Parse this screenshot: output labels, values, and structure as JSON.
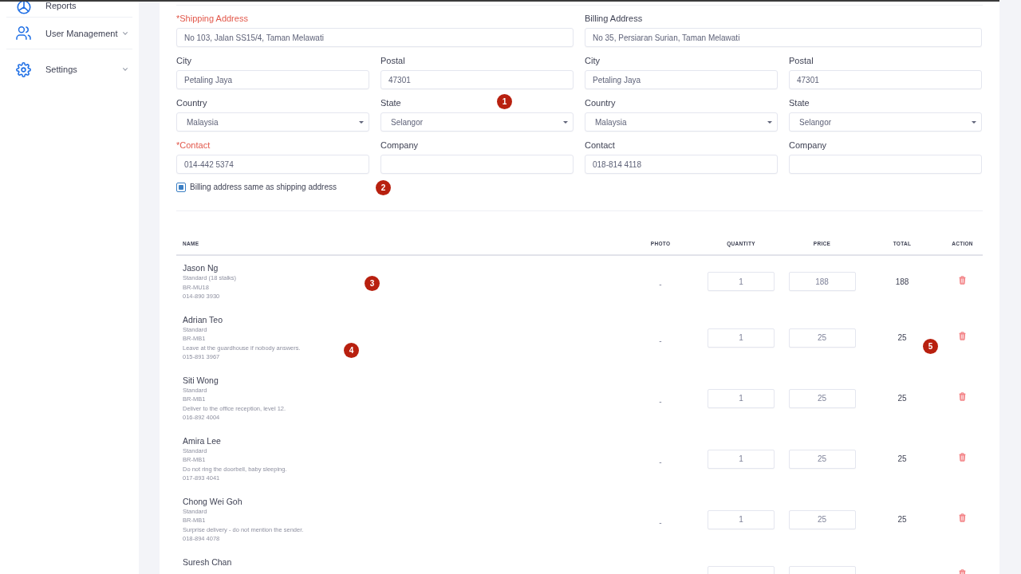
{
  "sidebar": {
    "items": [
      {
        "label": "Reports"
      },
      {
        "label": "User Management",
        "expanded": false
      },
      {
        "label": "Settings",
        "expanded": false
      }
    ]
  },
  "shipping": {
    "fields": [
      {
        "kind": "text",
        "label": "*Shipping Address",
        "required": true,
        "value": "No 103, Jalan SS15/4, Taman Melawati"
      },
      {
        "kind": "text",
        "label": "City",
        "required": false,
        "value": "Petaling Jaya"
      },
      {
        "kind": "text",
        "label": "Postal",
        "required": false,
        "value": "47301"
      },
      {
        "kind": "select",
        "label": "Country",
        "required": false,
        "value": "Malaysia"
      },
      {
        "kind": "select",
        "label": "State",
        "required": false,
        "value": "Selangor"
      },
      {
        "kind": "text",
        "label": "*Contact",
        "required": true,
        "value": "014-442 5374"
      },
      {
        "kind": "text",
        "label": "Company",
        "required": false
      }
    ]
  },
  "billing": {
    "fields": [
      {
        "kind": "text",
        "label": "Billing Address",
        "required": false,
        "value": "No 35, Persiaran Surian, Taman Melawati"
      },
      {
        "kind": "text",
        "label": "City",
        "required": false,
        "value": "Petaling Jaya"
      },
      {
        "kind": "text",
        "label": "Postal",
        "required": false,
        "value": "47301"
      },
      {
        "kind": "select",
        "label": "Country",
        "required": false,
        "value": "Malaysia"
      },
      {
        "kind": "select",
        "label": "State",
        "required": false,
        "value": "Selangor"
      },
      {
        "kind": "text",
        "label": "Contact",
        "required": false,
        "value": "018-814 4118"
      },
      {
        "kind": "text",
        "label": "Company",
        "required": false
      }
    ]
  },
  "same_as_shipping": {
    "label": "Billing address same as shipping address",
    "checked": true
  },
  "table": {
    "columns": [
      "NAME",
      "PHOTO",
      "QUANTITY",
      "PRICE",
      "TOTAL",
      "ACTION"
    ],
    "rows": [
      {
        "name": "Jason Ng",
        "details": [
          "Standard (18 stalks)",
          "BR-MU18",
          "014-890 3930"
        ],
        "photo": "-",
        "quantity": "1",
        "price": "188",
        "total": "188"
      },
      {
        "name": "Adrian Teo",
        "details": [
          "Standard",
          "BR-MB1",
          "Leave at the guardhouse if nobody answers.",
          "015-891 3967"
        ],
        "photo": "-",
        "quantity": "1",
        "price": "25",
        "total": "25"
      },
      {
        "name": "Siti Wong",
        "details": [
          "Standard",
          "BR-MB1",
          "Deliver to the office reception, level 12.",
          "016-892 4004"
        ],
        "photo": "-",
        "quantity": "1",
        "price": "25",
        "total": "25"
      },
      {
        "name": "Amira Lee",
        "details": [
          "Standard",
          "BR-MB1",
          "Do not ring the doorbell, baby sleeping.",
          "017-893 4041"
        ],
        "photo": "-",
        "quantity": "1",
        "price": "25",
        "total": "25"
      },
      {
        "name": "Chong Wei Goh",
        "details": [
          "Standard",
          "BR-MB1",
          "Surprise delivery - do not mention the sender.",
          "018-894 4078"
        ],
        "photo": "-",
        "quantity": "1",
        "price": "25",
        "total": "25"
      },
      {
        "name": "Suresh Chan"
      }
    ]
  },
  "callout_markers": [
    "1",
    "2",
    "3",
    "4",
    "5"
  ]
}
